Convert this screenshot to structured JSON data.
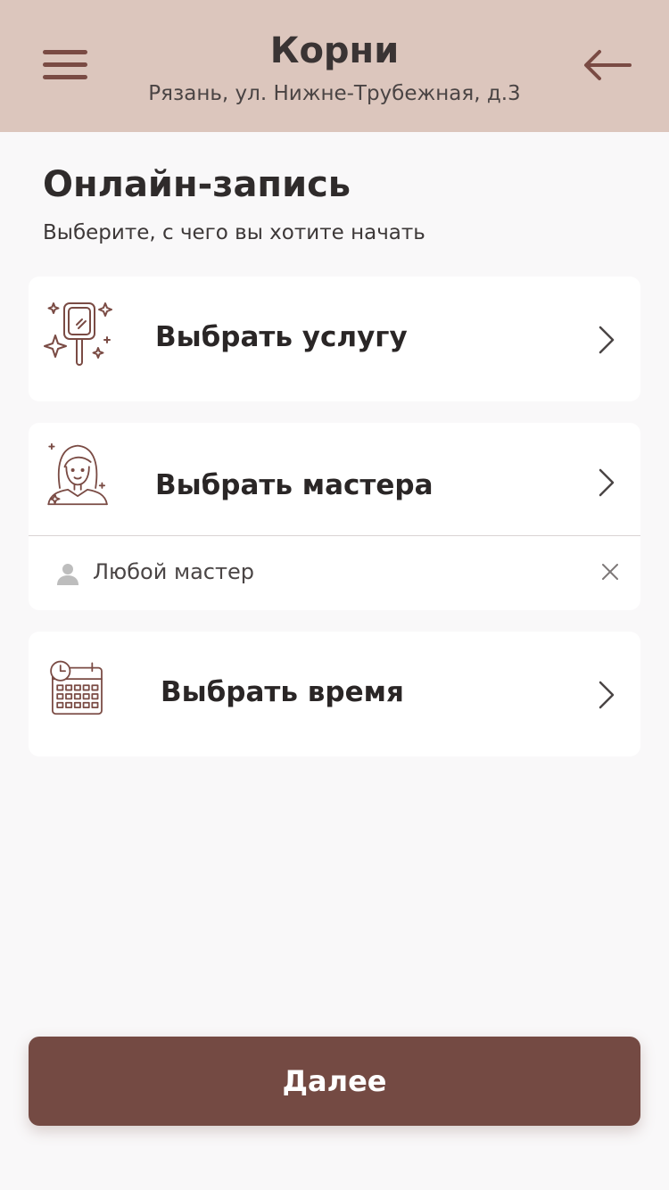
{
  "header": {
    "title": "Корни",
    "subtitle": "Рязань, ул. Нижне-Трубежная, д.3",
    "menu_icon": "hamburger-menu-icon",
    "back_icon": "arrow-left-icon"
  },
  "page": {
    "heading": "Онлайн-запись",
    "subheading": "Выберите, с чего вы хотите начать"
  },
  "options": {
    "service": {
      "label": "Выбрать услугу",
      "icon": "hand-mirror-sparkles-icon"
    },
    "master": {
      "label": "Выбрать мастера",
      "icon": "woman-master-icon",
      "selected": "Любой мастер",
      "selected_icon": "person-icon"
    },
    "time": {
      "label": "Выбрать время",
      "icon": "calendar-clock-icon"
    }
  },
  "footer": {
    "next_label": "Далее"
  },
  "colors": {
    "header_bg": "#dcc6bd",
    "accent": "#744a43",
    "page_bg": "#f9f8f9"
  }
}
